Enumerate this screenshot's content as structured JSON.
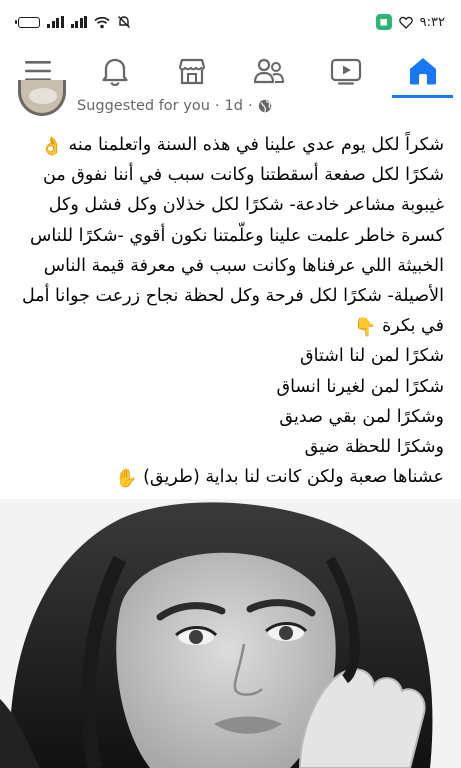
{
  "status_bar": {
    "time": "٩:٣٢",
    "icons": [
      "battery-icon",
      "signal-icon",
      "signal-icon",
      "wifi-icon",
      "mute-icon",
      "app-notification-icon",
      "heart-icon"
    ]
  },
  "nav": {
    "items": [
      {
        "name": "menu",
        "icon": "hamburger-menu-icon"
      },
      {
        "name": "notifications",
        "icon": "bell-icon"
      },
      {
        "name": "marketplace",
        "icon": "marketplace-icon"
      },
      {
        "name": "groups",
        "icon": "groups-icon"
      },
      {
        "name": "watch",
        "icon": "video-icon"
      },
      {
        "name": "home",
        "icon": "home-icon",
        "active": true
      }
    ],
    "accent": "#1877f2"
  },
  "post": {
    "suggested": "Suggested for you",
    "separator1": "·",
    "time": "1d",
    "separator2": "·",
    "audience_icon": "globe-icon",
    "lines": [
      "شكراً لكل يوم عدي علينا في هذه السنة واتعلمنا منه",
      "شكرًا لكل صفعة أسقطتنا وكانت سبب في أننا نفوق من",
      "غيبوبة مشاعر خادعة- شكرًا لكل خذلان وكل فشل وكل",
      "كسرة خاطر علمت علينا وعلّمتنا نكون أقوي -شكرًا للناس",
      "الخبيثة اللي عرفناها وكانت سبب في معرفة قيمة الناس",
      "الأصيلة- شكرًا لكل فرحة وكل لحظة نجاح زرعت جوانا أمل",
      "في بكرة",
      "شكرًا لمن لنا اشتاق",
      "شكرًا لمن لغيرنا انساق",
      "وشكرًا لمن بقي صديق",
      "وشكرًا للحظة ضيق",
      "عشناها صعبة ولكن كانت لنا بداية (طريق)"
    ],
    "emoji_ok": "👌",
    "emoji_point": "👇",
    "emoji_hand": "✋"
  }
}
